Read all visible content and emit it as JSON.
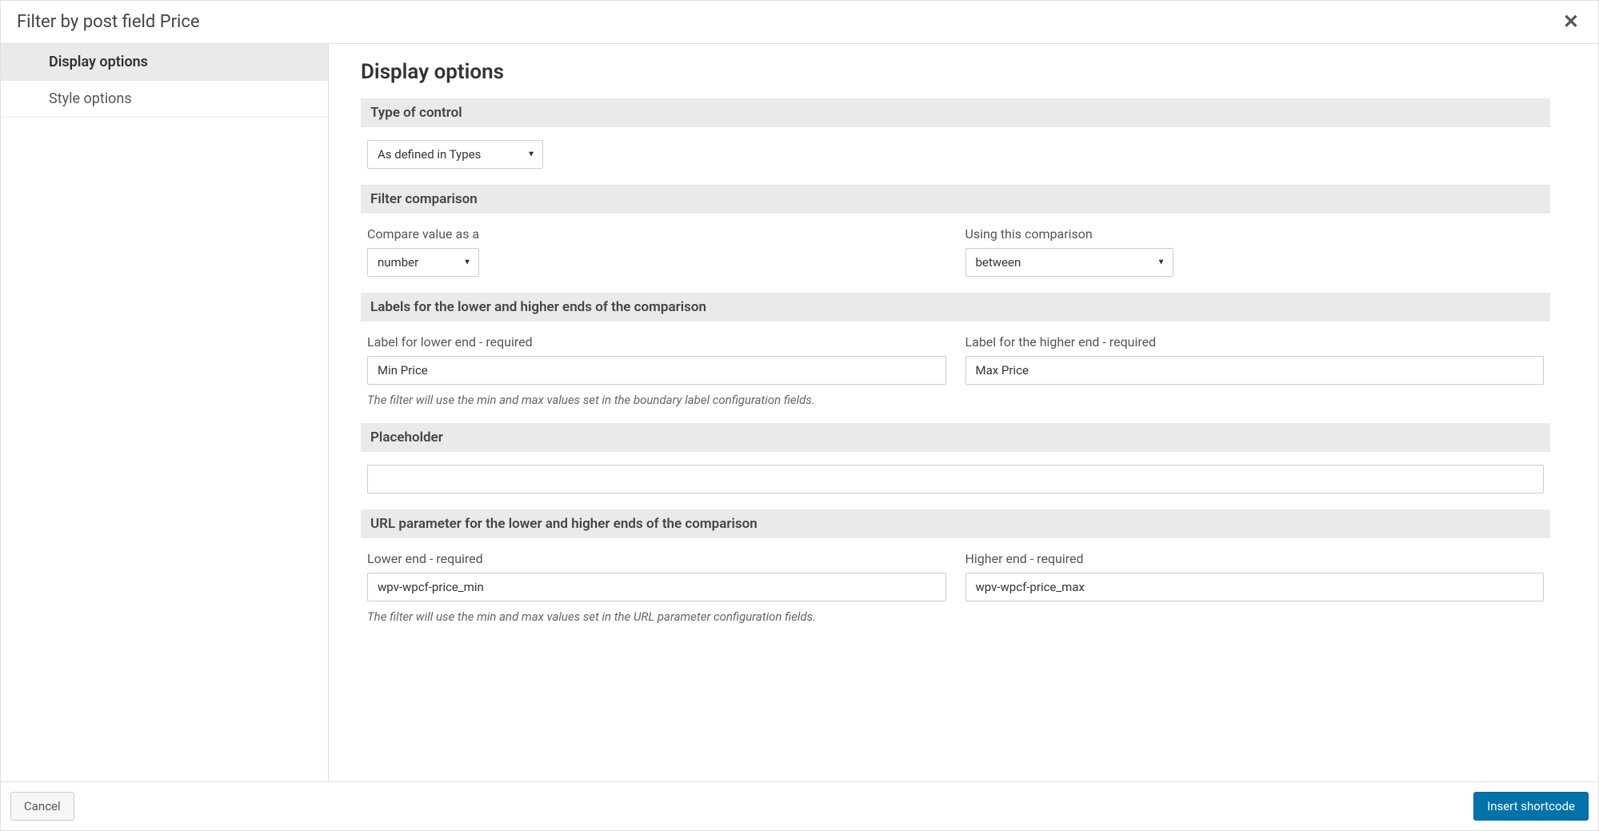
{
  "header": {
    "title": "Filter by post field Price"
  },
  "sidebar": {
    "items": [
      {
        "label": "Display options",
        "active": true
      },
      {
        "label": "Style options",
        "active": false
      }
    ]
  },
  "main": {
    "title": "Display options",
    "sections": {
      "type_of_control": {
        "header": "Type of control",
        "value": "As defined in Types"
      },
      "filter_comparison": {
        "header": "Filter comparison",
        "compare_label": "Compare value as a",
        "compare_value": "number",
        "using_label": "Using this comparison",
        "using_value": "between"
      },
      "labels": {
        "header": "Labels for the lower and higher ends of the comparison",
        "lower_label": "Label for lower end - required",
        "lower_value": "Min Price",
        "higher_label": "Label for the higher end - required",
        "higher_value": "Max Price",
        "hint": "The filter will use the min and max values set in the boundary label configuration fields."
      },
      "placeholder": {
        "header": "Placeholder",
        "value": ""
      },
      "url_params": {
        "header": "URL parameter for the lower and higher ends of the comparison",
        "lower_label": "Lower end - required",
        "lower_value": "wpv-wpcf-price_min",
        "higher_label": "Higher end - required",
        "higher_value": "wpv-wpcf-price_max",
        "hint": "The filter will use the min and max values set in the URL parameter configuration fields."
      }
    }
  },
  "footer": {
    "cancel_label": "Cancel",
    "insert_label": "Insert shortcode"
  }
}
